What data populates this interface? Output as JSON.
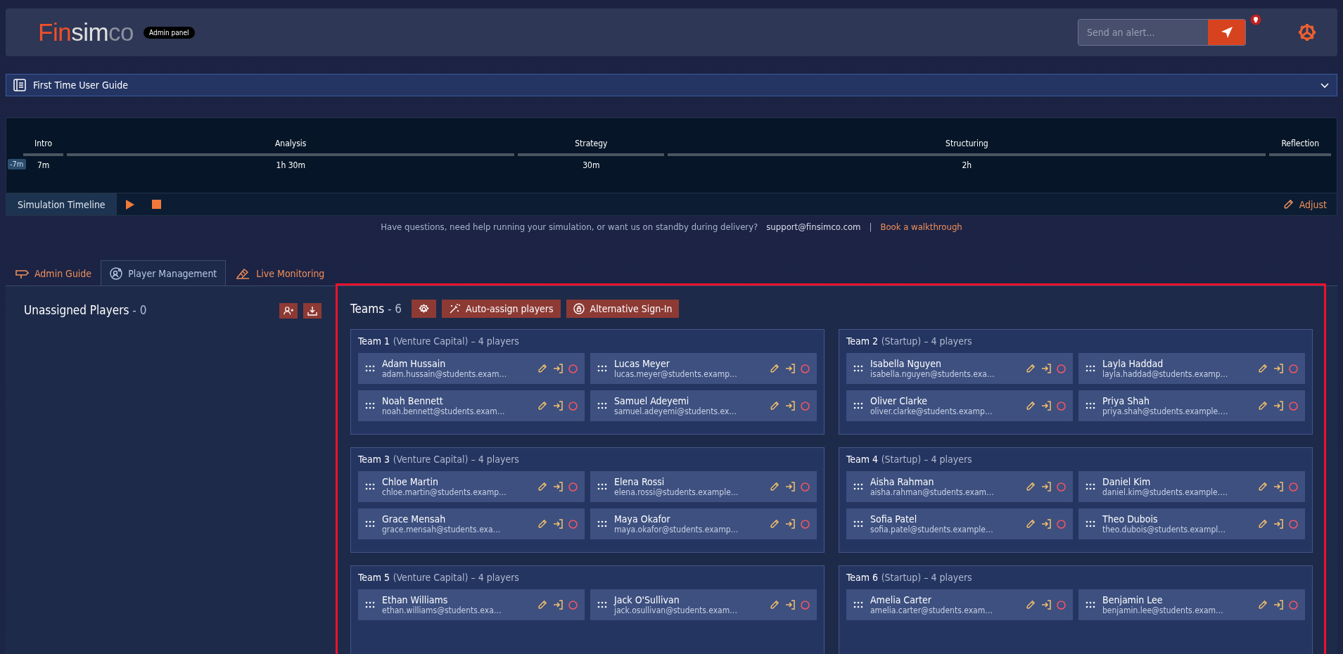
{
  "header": {
    "logo": {
      "part_1": "Fin",
      "part_2": "sim",
      "part_3": "co"
    },
    "badge": "Admin panel",
    "alert": {
      "placeholder": "Send an alert..."
    }
  },
  "guide": {
    "title": "First Time User Guide",
    "expanded": false
  },
  "timeline": {
    "phases": [
      {
        "label": "Intro",
        "duration": "7m"
      },
      {
        "label": "Analysis",
        "duration": "1h 30m"
      },
      {
        "label": "Strategy",
        "duration": "30m"
      },
      {
        "label": "Structuring",
        "duration": "2h"
      },
      {
        "label": "Reflection"
      }
    ],
    "offset": "-7m",
    "title": "Simulation Timeline",
    "adjust": "Adjust"
  },
  "help": {
    "text": "Have questions, need help running your simulation, or want us on standby during delivery?",
    "email": "support@finsimco.com",
    "separator": "|",
    "link": "Book a walkthrough"
  },
  "tabs": [
    {
      "label": "Admin Guide",
      "kind": "guide",
      "selected": false
    },
    {
      "label": "Player Management",
      "kind": "players",
      "selected": true
    },
    {
      "label": "Live Monitoring",
      "kind": "monitor",
      "selected": false
    }
  ],
  "unassigned": {
    "title": "Unassigned Players",
    "count": "- 0"
  },
  "teams": {
    "title": "Teams",
    "count": "- 6",
    "actions": [
      {
        "label": "Auto-assign players",
        "kind": "wand"
      },
      {
        "label": "Alternative Sign-In",
        "kind": "lock"
      }
    ],
    "items": [
      {
        "name": "Team 1",
        "detail": "(Venture Capital) – 4 players",
        "players": [
          {
            "name": "Adam Hussain",
            "email": "adam.hussain@students.exam…"
          },
          {
            "name": "Lucas Meyer",
            "email": "lucas.meyer@students.examp…"
          },
          {
            "name": "Noah Bennett",
            "email": "noah.bennett@students.exam…"
          },
          {
            "name": "Samuel Adeyemi",
            "email": "samuel.adeyemi@students.ex…"
          }
        ]
      },
      {
        "name": "Team 2",
        "detail": "(Startup) – 4 players",
        "players": [
          {
            "name": "Isabella Nguyen",
            "email": "isabella.nguyen@students.exa…"
          },
          {
            "name": "Layla Haddad",
            "email": "layla.haddad@students.examp…"
          },
          {
            "name": "Oliver Clarke",
            "email": "oliver.clarke@students.examp…"
          },
          {
            "name": "Priya Shah",
            "email": "priya.shah@students.example.…"
          }
        ]
      },
      {
        "name": "Team 3",
        "detail": "(Venture Capital) – 4 players",
        "players": [
          {
            "name": "Chloe Martin",
            "email": "chloe.martin@students.examp…"
          },
          {
            "name": "Elena Rossi",
            "email": "elena.rossi@students.example…"
          },
          {
            "name": "Grace Mensah",
            "email": "grace.mensah@students.exa…"
          },
          {
            "name": "Maya Okafor",
            "email": "maya.okafor@students.examp…"
          }
        ]
      },
      {
        "name": "Team 4",
        "detail": "(Startup) – 4 players",
        "players": [
          {
            "name": "Aisha Rahman",
            "email": "aisha.rahman@students.exam…"
          },
          {
            "name": "Daniel Kim",
            "email": "daniel.kim@students.example.…"
          },
          {
            "name": "Sofia Patel",
            "email": "sofia.patel@students.example…"
          },
          {
            "name": "Theo Dubois",
            "email": "theo.dubois@students.exampl…"
          }
        ]
      },
      {
        "name": "Team 5",
        "detail": "(Venture Capital) – 4 players",
        "players": [
          {
            "name": "Ethan Williams",
            "email": "ethan.williams@students.exa…"
          },
          {
            "name": "Jack O'Sullivan",
            "email": "jack.osullivan@students.exam…"
          }
        ]
      },
      {
        "name": "Team 6",
        "detail": "(Startup) – 4 players",
        "players": [
          {
            "name": "Amelia Carter",
            "email": "amelia.carter@students.exam…"
          },
          {
            "name": "Benjamin Lee",
            "email": "benjamin.lee@students.exam…"
          }
        ]
      }
    ]
  }
}
